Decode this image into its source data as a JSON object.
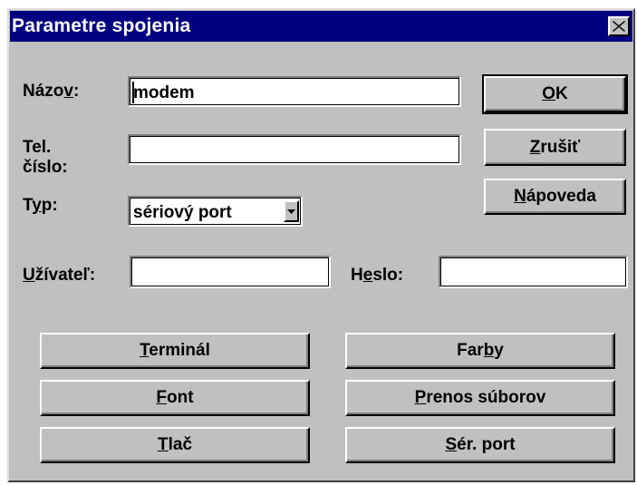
{
  "window": {
    "title": "Parametre spojenia"
  },
  "fields": {
    "nazov": {
      "label_pre": "Názo",
      "label_acc": "v",
      "label_post": ":",
      "value": "modem"
    },
    "tel": {
      "label_line1": "Tel.",
      "label_line2": "číslo:",
      "value": ""
    },
    "typ": {
      "label_pre": "T",
      "label_acc": "y",
      "label_post": "p:",
      "value": "sériový port"
    },
    "uzivatel": {
      "label_pre": "",
      "label_acc": "U",
      "label_post": "žívateľ:",
      "value": ""
    },
    "heslo": {
      "label_pre": "H",
      "label_acc": "e",
      "label_post": "slo:",
      "value": ""
    }
  },
  "buttons": {
    "ok": {
      "pre": "",
      "acc": "O",
      "post": "K"
    },
    "cancel": {
      "pre": "",
      "acc": "Z",
      "post": "rušiť"
    },
    "help": {
      "pre": "",
      "acc": "N",
      "post": "ápoveda"
    },
    "terminal": {
      "pre": "",
      "acc": "T",
      "post": "erminál"
    },
    "font": {
      "pre": "",
      "acc": "F",
      "post": "ont"
    },
    "print": {
      "pre": "",
      "acc": "T",
      "post": "lač"
    },
    "colors": {
      "pre": "Far",
      "acc": "b",
      "post": "y"
    },
    "transfer": {
      "pre": "",
      "acc": "P",
      "post": "renos súborov"
    },
    "serial": {
      "pre": "",
      "acc": "S",
      "post": "ér. port"
    }
  },
  "icons": {
    "close": "close-icon",
    "dropdown": "dropdown-arrow-icon"
  }
}
